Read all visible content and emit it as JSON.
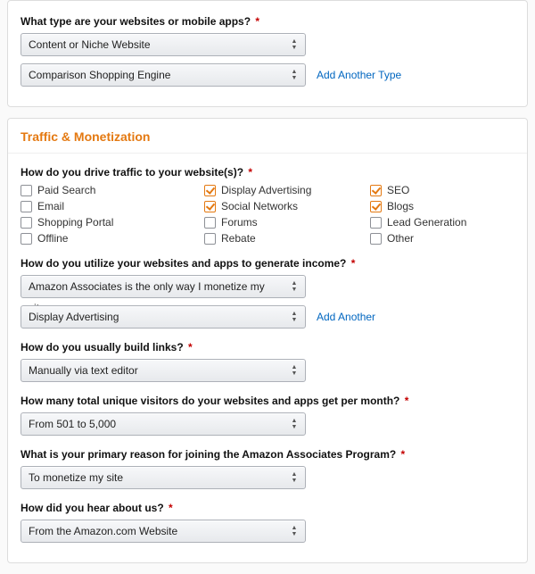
{
  "top": {
    "question": "What type are your websites or mobile apps?",
    "select1": "Content or Niche Website",
    "select2": "Comparison Shopping Engine",
    "add_link": "Add Another Type"
  },
  "section_title": "Traffic & Monetization",
  "traffic": {
    "question": "How do you drive traffic to your website(s)?",
    "checkboxes": [
      {
        "label": "Paid Search",
        "checked": false
      },
      {
        "label": "Display Advertising",
        "checked": true
      },
      {
        "label": "SEO",
        "checked": true
      },
      {
        "label": "Email",
        "checked": false
      },
      {
        "label": "Social Networks",
        "checked": true
      },
      {
        "label": "Blogs",
        "checked": true
      },
      {
        "label": "Shopping Portal",
        "checked": false
      },
      {
        "label": "Forums",
        "checked": false
      },
      {
        "label": "Lead Generation",
        "checked": false
      },
      {
        "label": "Offline",
        "checked": false
      },
      {
        "label": "Rebate",
        "checked": false
      },
      {
        "label": "Other",
        "checked": false
      }
    ]
  },
  "income": {
    "question": "How do you utilize your websites and apps to generate income?",
    "select1": "Amazon Associates is the only way I monetize my site",
    "select2": "Display Advertising",
    "add_link": "Add Another"
  },
  "build_links": {
    "question": "How do you usually build links?",
    "select": "Manually via text editor"
  },
  "visitors": {
    "question": "How many total unique visitors do your websites and apps get per month?",
    "select": "From 501 to 5,000"
  },
  "reason": {
    "question": "What is your primary reason for joining the Amazon Associates Program?",
    "select": "To monetize my site"
  },
  "hear": {
    "question": "How did you hear about us?",
    "select": "From the Amazon.com Website"
  }
}
